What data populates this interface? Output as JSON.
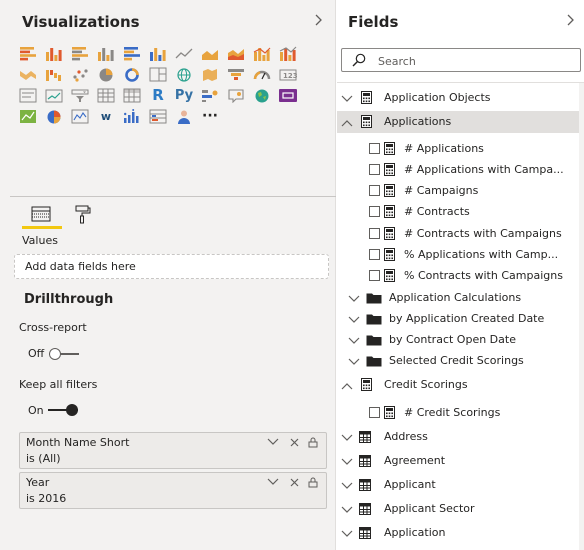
{
  "visualizations": {
    "title": "Visualizations",
    "collapse_icon": "chevron-right-icon",
    "icon_rows": [
      [
        "stacked-bar-chart-icon",
        "stacked-column-chart-icon",
        "clustered-bar-chart-icon",
        "clustered-column-chart-icon",
        "100-stacked-bar-chart-icon",
        "100-stacked-column-chart-icon",
        "line-chart-icon",
        "area-chart-icon",
        "stacked-area-chart-icon",
        "line-and-column-chart-icon",
        "line-and-clustered-column-chart-icon"
      ],
      [
        "ribbon-chart-icon",
        "waterfall-chart-icon",
        "scatter-chart-icon",
        "pie-chart-icon",
        "donut-chart-icon",
        "treemap-icon",
        "map-icon",
        "filled-map-icon",
        "funnel-icon",
        "gauge-icon",
        "card-icon"
      ],
      [
        "multi-row-card-icon",
        "kpi-icon",
        "slicer-icon",
        "table-icon",
        "matrix-icon",
        "r-script-visual-icon",
        "python-visual-icon",
        "key-influencers-icon",
        "qa-visual-icon",
        "globe-map-icon",
        "custom-visual-icon"
      ],
      [
        "hierarchy-chart-icon",
        "pie-custom-icon",
        "line-sparkline-icon",
        "word-cloud-icon",
        "bar-dot-icon",
        "table-custom-icon",
        "person-icon",
        "more-visuals-icon"
      ]
    ],
    "text_icons": {
      "r": "R",
      "py": "Py",
      "w": "w",
      "more": "···"
    },
    "values_label": "Values",
    "drop_zone_text": "Add data fields here",
    "drillthrough": {
      "title": "Drillthrough",
      "cross_report_label": "Cross-report",
      "cross_report_state": "Off",
      "keep_filters_label": "Keep all filters",
      "keep_filters_state": "On"
    },
    "filters": [
      {
        "name": "Month Name Short",
        "value": "is (All)"
      },
      {
        "name": "Year",
        "value": "is 2016"
      }
    ]
  },
  "fields": {
    "title": "Fields",
    "collapse_icon": "chevron-right-icon",
    "search_placeholder": "Search",
    "items": [
      {
        "label": "Application Objects",
        "kind": "table-group",
        "expanded": false,
        "indent": 0,
        "selected": false
      },
      {
        "label": "Applications",
        "kind": "table-group",
        "expanded": true,
        "indent": 0,
        "selected": true
      },
      {
        "label": "# Applications",
        "kind": "measure",
        "indent": 2
      },
      {
        "label": "# Applications with Campa...",
        "kind": "measure",
        "indent": 2
      },
      {
        "label": "# Campaigns",
        "kind": "measure",
        "indent": 2
      },
      {
        "label": "# Contracts",
        "kind": "measure",
        "indent": 2
      },
      {
        "label": "# Contracts with Campaigns",
        "kind": "measure",
        "indent": 2
      },
      {
        "label": "% Applications with Camp...",
        "kind": "measure",
        "indent": 2
      },
      {
        "label": "% Contracts with Campaigns",
        "kind": "measure",
        "indent": 2
      },
      {
        "label": "Application Calculations",
        "kind": "folder",
        "indent": 1
      },
      {
        "label": "by Application Created Date",
        "kind": "folder",
        "indent": 1
      },
      {
        "label": "by Contract Open Date",
        "kind": "folder",
        "indent": 1
      },
      {
        "label": "Selected Credit Scorings",
        "kind": "folder",
        "indent": 1
      },
      {
        "label": "Credit Scorings",
        "kind": "table-group",
        "expanded": true,
        "indent": 0
      },
      {
        "label": "# Credit Scorings",
        "kind": "measure",
        "indent": 2
      },
      {
        "label": "Address",
        "kind": "table",
        "indent": 0
      },
      {
        "label": "Agreement",
        "kind": "table",
        "indent": 0
      },
      {
        "label": "Applicant",
        "kind": "table",
        "indent": 0
      },
      {
        "label": "Applicant Sector",
        "kind": "table",
        "indent": 0
      },
      {
        "label": "Application",
        "kind": "table",
        "indent": 0
      }
    ]
  },
  "colors": {
    "accent": "#f2c811",
    "pane_bg": "#f3f2f1",
    "selected_row": "#e1dfdd",
    "r_blue": "#2c7bc5",
    "py_blue": "#3572a5"
  }
}
